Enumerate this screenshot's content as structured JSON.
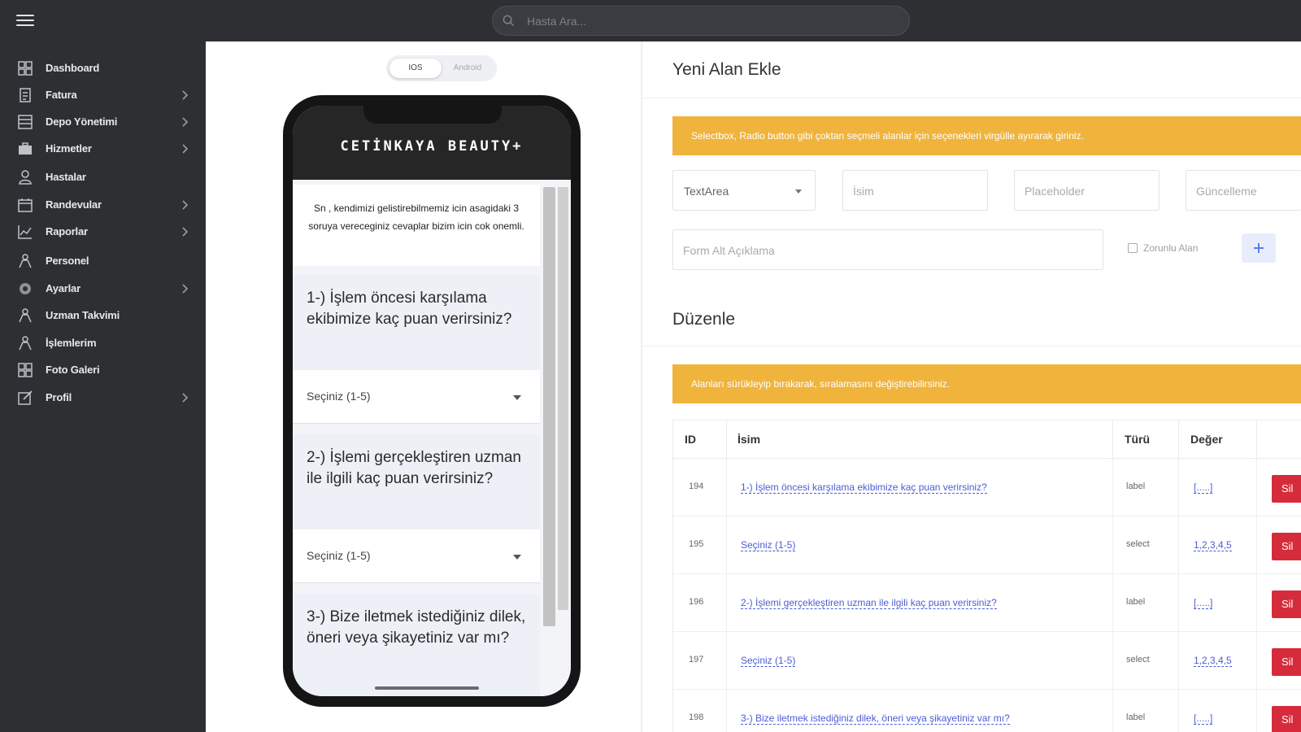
{
  "search": {
    "placeholder": "Hasta Ara..."
  },
  "sidebar": {
    "items": [
      {
        "label": "Dashboard",
        "icon": "dashboard-icon",
        "chevron": false
      },
      {
        "label": "Fatura",
        "icon": "invoice-icon",
        "chevron": true
      },
      {
        "label": "Depo Yönetimi",
        "icon": "warehouse-icon",
        "chevron": true
      },
      {
        "label": "Hizmetler",
        "icon": "briefcase-icon",
        "chevron": true
      },
      {
        "label": "Hastalar",
        "icon": "patient-icon",
        "chevron": false
      },
      {
        "label": "Randevular",
        "icon": "calendar-icon",
        "chevron": true
      },
      {
        "label": "Raporlar",
        "icon": "chart-icon",
        "chevron": true
      },
      {
        "label": "Personel",
        "icon": "staff-icon",
        "chevron": false
      },
      {
        "label": "Ayarlar",
        "icon": "settings-icon",
        "chevron": true
      },
      {
        "label": "Uzman Takvimi",
        "icon": "expert-icon",
        "chevron": false
      },
      {
        "label": "İşlemlerim",
        "icon": "tasks-icon",
        "chevron": false
      },
      {
        "label": "Foto Galeri",
        "icon": "gallery-icon",
        "chevron": false
      },
      {
        "label": "Profil",
        "icon": "profile-icon",
        "chevron": true
      }
    ]
  },
  "preview": {
    "toggle": {
      "ios": "IOS",
      "android": "Android"
    },
    "brand": "CETİNKAYA BEAUTY+",
    "intro": "Sn , kendimizi gelistirebilmemiz icin asagidaki 3 soruya vereceginiz cevaplar bizim icin cok onemli.",
    "questions": [
      "1-) İşlem öncesi karşılama ekibimize kaç puan verirsiniz?",
      "2-) İşlemi gerçekleştiren uzman ile ilgili kaç puan verirsiniz?",
      "3-) Bize iletmek istediğiniz dilek, öneri veya şikayetiniz var mı?"
    ],
    "select_placeholder": "Seçiniz (1-5)"
  },
  "form": {
    "title": "Yeni Alan Ekle",
    "alert": "Selectbox, Radio button gibi çoktan seçmeli alanlar için seçenekleri virgülle ayırarak giriniz.",
    "type_value": "TextArea",
    "name_placeholder": "İsim",
    "placeholder_placeholder": "Placeholder",
    "update_placeholder": "Güncelleme",
    "desc_placeholder": "Form Alt Açıklama",
    "required_label": "Zorunlu Alan"
  },
  "edit": {
    "title": "Düzenle",
    "alert": "Alanları sürükleyip bırakarak, sıralamasını değiştirebilirsiniz.",
    "columns": [
      "ID",
      "İsim",
      "Türü",
      "Değer"
    ],
    "delete_label": "Sil",
    "rows": [
      {
        "id": "194",
        "name": "1-) İşlem öncesi karşılama ekibimize kaç puan verirsiniz?",
        "type": "label",
        "value": "[.....]"
      },
      {
        "id": "195",
        "name": "Seçiniz (1-5)",
        "type": "select",
        "value": "1,2,3,4,5"
      },
      {
        "id": "196",
        "name": "2-) İşlemi gerçekleştiren uzman ile ilgili kaç puan verirsiniz?",
        "type": "label",
        "value": "[.....]"
      },
      {
        "id": "197",
        "name": "Seçiniz (1-5)",
        "type": "select",
        "value": "1,2,3,4,5"
      },
      {
        "id": "198",
        "name": "3-) Bize iletmek istediğiniz dilek, öneri veya şikayetiniz var mı?",
        "type": "label",
        "value": "[.....]"
      }
    ]
  },
  "colors": {
    "sidebar_bg": "#2d2f33",
    "alert_bg": "#f0b43c",
    "delete_bg": "#d62b3b",
    "link": "#4b5dd6",
    "accent": "#5b7cf5"
  }
}
